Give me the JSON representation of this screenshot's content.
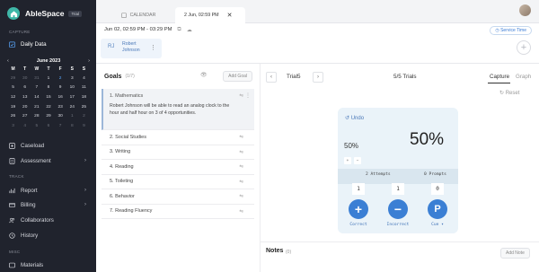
{
  "app": {
    "name": "AbleSpace",
    "badge": "Trial",
    "brand_color": "#3fb7a8"
  },
  "sidebar": {
    "sections": {
      "capture": "CAPTURE",
      "track": "TRACK",
      "misc": "MISC"
    },
    "items": [
      {
        "label": "Daily Data",
        "icon": "calendar-check-icon",
        "active": true
      },
      {
        "label": "Caseload",
        "icon": "caseload-icon"
      },
      {
        "label": "Assessment",
        "icon": "assessment-icon",
        "chevron": "›"
      },
      {
        "label": "Report",
        "icon": "report-icon",
        "chevron": "›"
      },
      {
        "label": "Billing",
        "icon": "billing-icon",
        "chevron": "›"
      },
      {
        "label": "Collaborators",
        "icon": "collaborators-icon"
      },
      {
        "label": "History",
        "icon": "history-icon"
      },
      {
        "label": "Materials",
        "icon": "materials-icon"
      }
    ]
  },
  "calendar": {
    "month": "June 2023",
    "prev": "‹",
    "next": "›",
    "weekdays": [
      "M",
      "T",
      "W",
      "T",
      "F",
      "S",
      "S"
    ],
    "weeks": [
      [
        "29",
        "30",
        "31",
        "1",
        "2",
        "3",
        "4"
      ],
      [
        "5",
        "6",
        "7",
        "8",
        "9",
        "10",
        "11"
      ],
      [
        "12",
        "13",
        "14",
        "15",
        "16",
        "17",
        "18"
      ],
      [
        "19",
        "20",
        "21",
        "22",
        "23",
        "24",
        "25"
      ],
      [
        "26",
        "27",
        "28",
        "29",
        "30",
        "1",
        "2"
      ],
      [
        "3",
        "4",
        "5",
        "6",
        "7",
        "8",
        "9"
      ]
    ]
  },
  "tabs": [
    {
      "label": "CALENDAR",
      "icon": "calendar-icon"
    },
    {
      "label": "2 Jun, 02:59 PM",
      "close": "✕"
    }
  ],
  "session": {
    "datetime": "Jun 02, 02:59 PM - 03:29 PM",
    "service_time": "Service Time",
    "student_initials": "RJ",
    "student_name_line1": "Robert",
    "student_name_line2": "Johnson",
    "add": "+"
  },
  "goals": {
    "title": "Goals",
    "count": "(1/7)",
    "add_label": "Add Goal",
    "items": [
      {
        "label": "1. Mathematics",
        "description": "Robert Johnson will be able to read an analog clock to the hour and half hour on 3 of 4 opportunities."
      },
      {
        "label": "2. Social Studies"
      },
      {
        "label": "3. Writing"
      },
      {
        "label": "4. Reading"
      },
      {
        "label": "5. Toileting"
      },
      {
        "label": "6. Behavior"
      },
      {
        "label": "7. Reading Fluency"
      }
    ]
  },
  "trial": {
    "prev": "‹",
    "next": "›",
    "label": "Trial5",
    "trials_label": "5/5 Trials",
    "capture_tab": "Capture",
    "graph_tab": "Graph",
    "reset_label": "Reset",
    "undo_label": "Undo",
    "percent_small": "50%",
    "percent_large": "50%",
    "plus": "+",
    "minus": "−",
    "attempts_label": "2 Attempts",
    "prompts_label": "0 Prompts",
    "counts": [
      "1",
      "1",
      "0"
    ],
    "buttons": [
      {
        "label": "Correct",
        "symbol": "+"
      },
      {
        "label": "Incorrect",
        "symbol": "−"
      },
      {
        "label": "Cue ▾",
        "symbol": "P"
      }
    ],
    "accent": "#3b7fd4"
  },
  "notes": {
    "title": "Notes",
    "count": "(0)",
    "add_label": "Add Note"
  }
}
